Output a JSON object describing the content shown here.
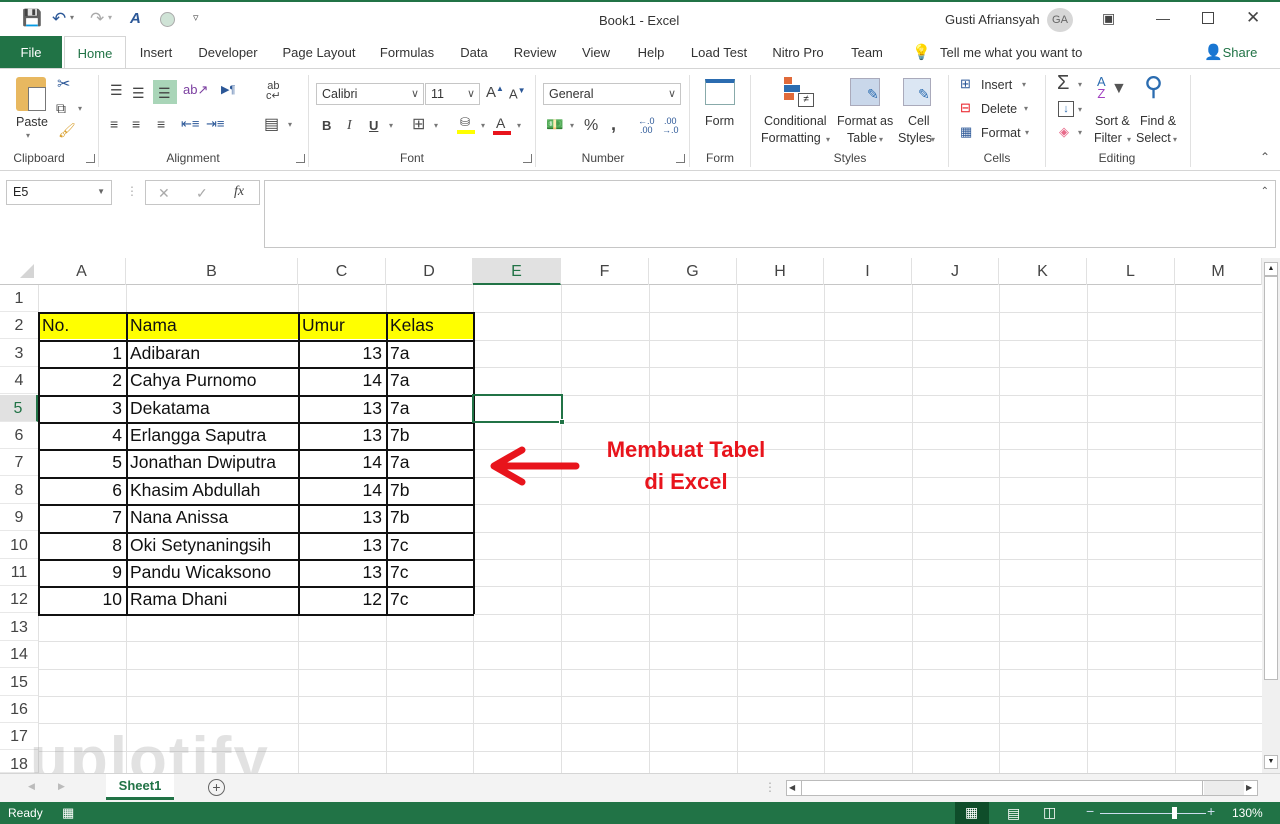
{
  "titlebar": {
    "doc_title": "Book1  -  Excel",
    "user_name": "Gusti Afriansyah",
    "user_initials": "GA",
    "quick_access": [
      "save-icon",
      "undo-icon",
      "redo-icon",
      "touch-mode-icon",
      "circle-icon",
      "customize-icon"
    ]
  },
  "tabs": [
    {
      "label": "File"
    },
    {
      "label": "Home"
    },
    {
      "label": "Insert"
    },
    {
      "label": "Developer"
    },
    {
      "label": "Page Layout"
    },
    {
      "label": "Formulas"
    },
    {
      "label": "Data"
    },
    {
      "label": "Review"
    },
    {
      "label": "View"
    },
    {
      "label": "Help"
    },
    {
      "label": "Load Test"
    },
    {
      "label": "Nitro Pro"
    },
    {
      "label": "Team"
    }
  ],
  "tell_me": "Tell me what you want to do",
  "share": "Share",
  "ribbon": {
    "clipboard": {
      "label": "Clipboard",
      "paste": "Paste"
    },
    "alignment": {
      "label": "Alignment"
    },
    "font": {
      "label": "Font",
      "font_name": "Calibri",
      "font_size": "11",
      "bold": "B",
      "italic": "I",
      "underline": "U"
    },
    "number": {
      "label": "Number",
      "format": "General",
      "percent": "%",
      "comma": ","
    },
    "form": {
      "label": "Form",
      "button": "Form"
    },
    "styles": {
      "label": "Styles",
      "conditional": [
        "Conditional",
        "Formatting"
      ],
      "format_table": [
        "Format as",
        "Table"
      ],
      "cell_styles": [
        "Cell",
        "Styles"
      ]
    },
    "cells": {
      "label": "Cells",
      "insert": "Insert",
      "delete": "Delete",
      "format": "Format"
    },
    "editing": {
      "label": "Editing",
      "sort": [
        "Sort &",
        "Filter"
      ],
      "find": [
        "Find &",
        "Select"
      ]
    }
  },
  "formula_bar": {
    "name_box": "E5",
    "formula": ""
  },
  "columns": [
    "A",
    "B",
    "C",
    "D",
    "E",
    "F",
    "G",
    "H",
    "I",
    "J",
    "K",
    "L",
    "M"
  ],
  "selected_column": "E",
  "rows": [
    "1",
    "2",
    "3",
    "4",
    "5",
    "6",
    "7",
    "8",
    "9",
    "10",
    "11",
    "12",
    "13",
    "14",
    "15",
    "16",
    "17",
    "18"
  ],
  "selected_row": "5",
  "table": {
    "headers": [
      "No.",
      "Nama",
      "Umur",
      "Kelas"
    ],
    "rows": [
      [
        "1",
        "Adibaran",
        "13",
        "7a"
      ],
      [
        "2",
        "Cahya Purnomo",
        "14",
        "7a"
      ],
      [
        "3",
        "Dekatama",
        "13",
        "7a"
      ],
      [
        "4",
        "Erlangga Saputra",
        "13",
        "7b"
      ],
      [
        "5",
        "Jonathan Dwiputra",
        "14",
        "7a"
      ],
      [
        "6",
        "Khasim Abdullah",
        "14",
        "7b"
      ],
      [
        "7",
        "Nana Anissa",
        "13",
        "7b"
      ],
      [
        "8",
        "Oki Setynaningsih",
        "13",
        "7c"
      ],
      [
        "9",
        "Pandu Wicaksono",
        "13",
        "7c"
      ],
      [
        "10",
        "Rama Dhani",
        "12",
        "7c"
      ]
    ]
  },
  "annotation": {
    "line1": "Membuat Tabel",
    "line2": "di Excel",
    "color": "#e8141c"
  },
  "sheets": [
    {
      "label": "Sheet1",
      "active": true
    }
  ],
  "status": {
    "text": "Ready",
    "zoom": "130%",
    "zoom_slider_position": 0.7
  },
  "watermark": "uplotify",
  "colors": {
    "accent": "#217346",
    "header_fill": "#ffff00"
  }
}
